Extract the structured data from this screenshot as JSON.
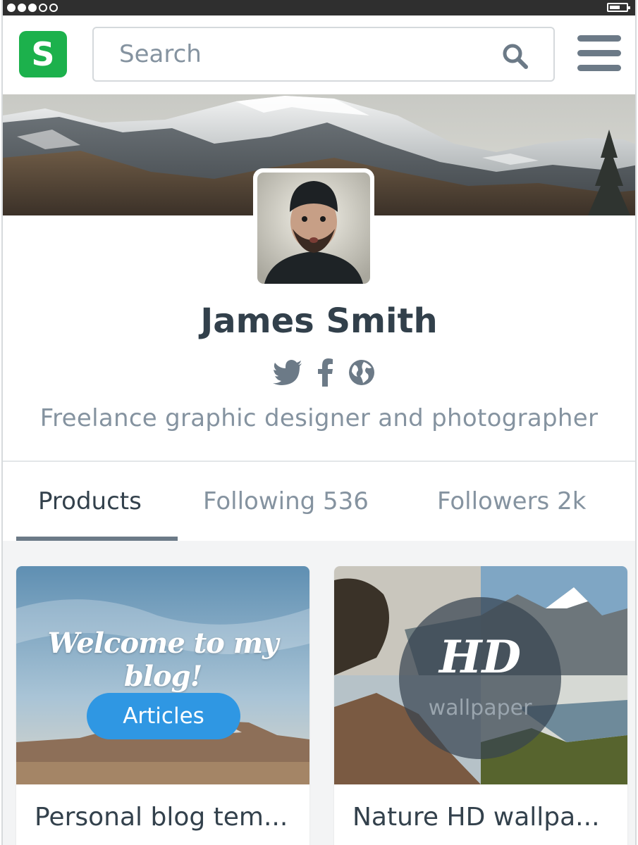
{
  "status_bar": {
    "signal_dots_filled": 3,
    "signal_dots_total": 5
  },
  "header": {
    "logo_letter": "S",
    "search_placeholder": "Search"
  },
  "profile": {
    "name": "James Smith",
    "bio": "Freelance graphic designer and photographer",
    "social_icons": [
      "twitter-icon",
      "facebook-icon",
      "globe-icon"
    ]
  },
  "tabs": [
    {
      "label": "Products",
      "active": true
    },
    {
      "label": "Following 536",
      "active": false
    },
    {
      "label": "Followers 2k",
      "active": false
    }
  ],
  "cards": [
    {
      "overlay_heading": "Welcome to my blog!",
      "button_label": "Articles",
      "title": "Personal blog tem..."
    },
    {
      "overlay_heading": "HD",
      "overlay_sub": "wallpaper",
      "title": "Nature HD wallpa..."
    }
  ],
  "colors": {
    "brand_green": "#1cb14c",
    "accent_blue": "#2f97e3",
    "text_dark": "#32404b",
    "text_muted": "#8593a0"
  }
}
